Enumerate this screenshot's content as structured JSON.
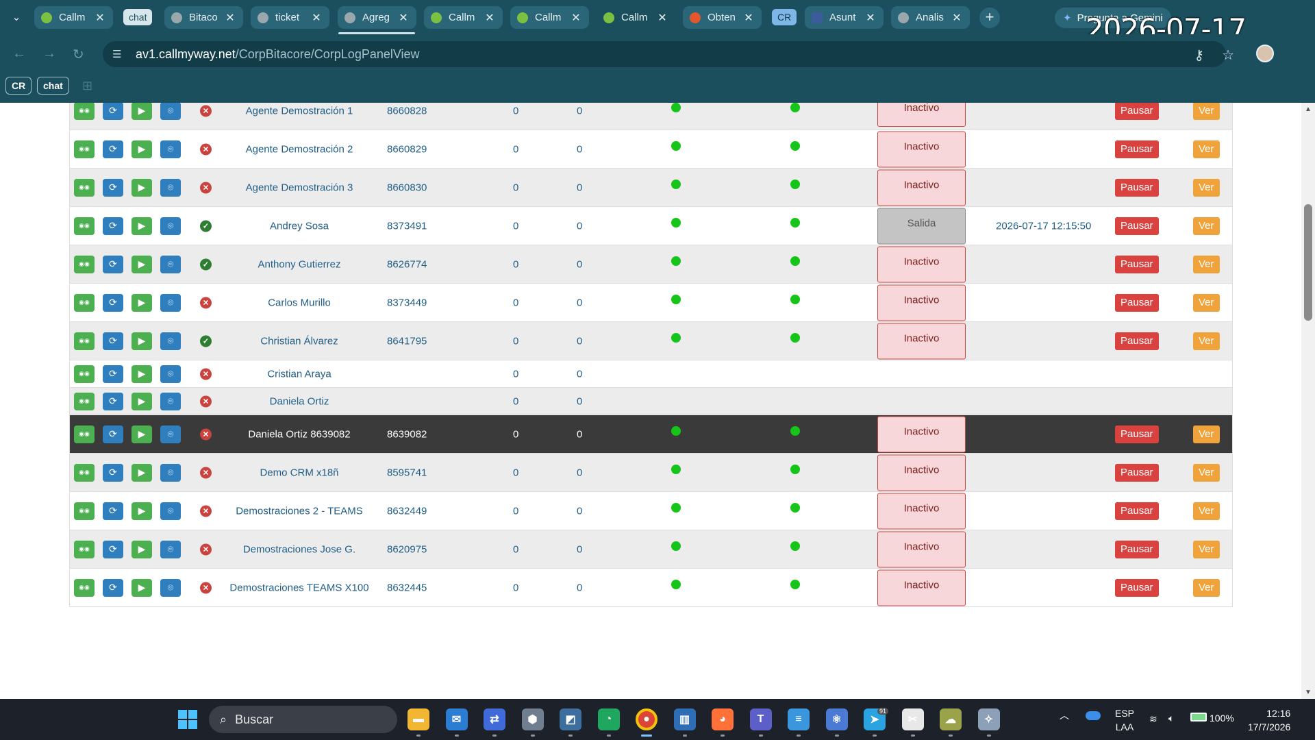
{
  "browser": {
    "tabs": [
      {
        "title": "Callm",
        "fav_color": "#7bc043",
        "active": false
      },
      {
        "title": "Bitaco",
        "fav_color": "#9aa8ad",
        "active": false
      },
      {
        "title": "ticket",
        "fav_color": "#9aa8ad",
        "active": false
      },
      {
        "title": "Agreg",
        "fav_color": "#9aa8ad",
        "active": false
      },
      {
        "title": "Callm",
        "fav_color": "#7bc043",
        "active": false
      },
      {
        "title": "Callm",
        "fav_color": "#7bc043",
        "active": false
      },
      {
        "title": "Callm",
        "fav_color": "#7bc043",
        "active": true
      },
      {
        "title": "Obten",
        "fav_color": "#e4572e",
        "active": false
      },
      {
        "title": "Asunt",
        "fav_color": "#3b5b9a",
        "active": false
      },
      {
        "title": "Analis",
        "fav_color": "#9aa8ad",
        "active": false
      }
    ],
    "tab_groups": {
      "chat": "chat",
      "cr": "CR"
    },
    "gemini_label": "Pregunta a Gemini",
    "url_host": "av1.callmyway.net",
    "url_path": "/CorpBitacore/CorpLogPanelView",
    "bookmarks": {
      "cr": "CR",
      "chat": "chat"
    },
    "overlay_clock": "2026-07-17 12:16"
  },
  "table": {
    "actions": {
      "pausar": "Pausar",
      "ver": "Ver"
    },
    "rows": [
      {
        "name": "Agente Demostración 1",
        "ext": "8660828",
        "n1": "0",
        "n2": "0",
        "status": "no",
        "dots": true,
        "state": "Inactivo",
        "state_time": "",
        "buttons": true
      },
      {
        "name": "Agente Demostración 2",
        "ext": "8660829",
        "n1": "0",
        "n2": "0",
        "status": "no",
        "dots": true,
        "state": "Inactivo",
        "state_time": "",
        "buttons": true
      },
      {
        "name": "Agente Demostración 3",
        "ext": "8660830",
        "n1": "0",
        "n2": "0",
        "status": "no",
        "dots": true,
        "state": "Inactivo",
        "state_time": "",
        "buttons": true
      },
      {
        "name": "Andrey Sosa",
        "ext": "8373491",
        "n1": "0",
        "n2": "0",
        "status": "ok",
        "dots": true,
        "state": "Salida",
        "state_time": "2026-07-17 12:15:50",
        "buttons": true
      },
      {
        "name": "Anthony Gutierrez",
        "ext": "8626774",
        "n1": "0",
        "n2": "0",
        "status": "ok",
        "dots": true,
        "state": "Inactivo",
        "state_time": "",
        "buttons": true
      },
      {
        "name": "Carlos Murillo",
        "ext": "8373449",
        "n1": "0",
        "n2": "0",
        "status": "no",
        "dots": true,
        "state": "Inactivo",
        "state_time": "",
        "buttons": true
      },
      {
        "name": "Christian Álvarez",
        "ext": "8641795",
        "n1": "0",
        "n2": "0",
        "status": "ok",
        "dots": true,
        "state": "Inactivo",
        "state_time": "",
        "buttons": true
      },
      {
        "name": "Cristian Araya",
        "ext": "",
        "n1": "0",
        "n2": "0",
        "status": "no",
        "dots": false,
        "state": "",
        "state_time": "",
        "buttons": false
      },
      {
        "name": "Daniela Ortiz",
        "ext": "",
        "n1": "0",
        "n2": "0",
        "status": "no",
        "dots": false,
        "state": "",
        "state_time": "",
        "buttons": false
      },
      {
        "name": "Daniela Ortiz 8639082",
        "ext": "8639082",
        "n1": "0",
        "n2": "0",
        "status": "no",
        "dots": true,
        "state": "Inactivo",
        "state_time": "",
        "buttons": true
      },
      {
        "name": "Demo CRM x18ñ",
        "ext": "8595741",
        "n1": "0",
        "n2": "0",
        "status": "no",
        "dots": true,
        "state": "Inactivo",
        "state_time": "",
        "buttons": true
      },
      {
        "name": "Demostraciones 2 - TEAMS",
        "ext": "8632449",
        "n1": "0",
        "n2": "0",
        "status": "no",
        "dots": true,
        "state": "Inactivo",
        "state_time": "",
        "buttons": true
      },
      {
        "name": "Demostraciones Jose G.",
        "ext": "8620975",
        "n1": "0",
        "n2": "0",
        "status": "no",
        "dots": true,
        "state": "Inactivo",
        "state_time": "",
        "buttons": true
      },
      {
        "name": "Demostraciones TEAMS X100",
        "ext": "8632445",
        "n1": "0",
        "n2": "0",
        "status": "no",
        "dots": true,
        "state": "Inactivo",
        "state_time": "",
        "buttons": true
      }
    ]
  },
  "taskbar": {
    "search_placeholder": "Buscar",
    "lang": "ESP",
    "lang_sub": "LAA",
    "battery": "100%",
    "time": "12:16",
    "date": "17/7/2026",
    "telegram_badge": "91",
    "apps": [
      {
        "name": "file-explorer",
        "color": "#f2b632"
      },
      {
        "name": "outlook",
        "color": "#2b7cd3"
      },
      {
        "name": "remote-desktop",
        "color": "#3f6ad8"
      },
      {
        "name": "virtualbox",
        "color": "#6f7f90"
      },
      {
        "name": "azure-data-studio",
        "color": "#3c6e9e"
      },
      {
        "name": "edge",
        "color": "#1fa65f"
      },
      {
        "name": "chrome",
        "color": "#db4437"
      },
      {
        "name": "books",
        "color": "#2f6db5"
      },
      {
        "name": "firefox",
        "color": "#ff7139"
      },
      {
        "name": "teams",
        "color": "#5b5fc7"
      },
      {
        "name": "notepad",
        "color": "#3a96dd"
      },
      {
        "name": "atom",
        "color": "#4b7ad4"
      },
      {
        "name": "telegram",
        "color": "#2aa3e0"
      },
      {
        "name": "snipping-tool",
        "color": "#e8e8e8"
      },
      {
        "name": "weather",
        "color": "#9aa24a"
      },
      {
        "name": "satellite",
        "color": "#8ca0b8"
      }
    ]
  }
}
